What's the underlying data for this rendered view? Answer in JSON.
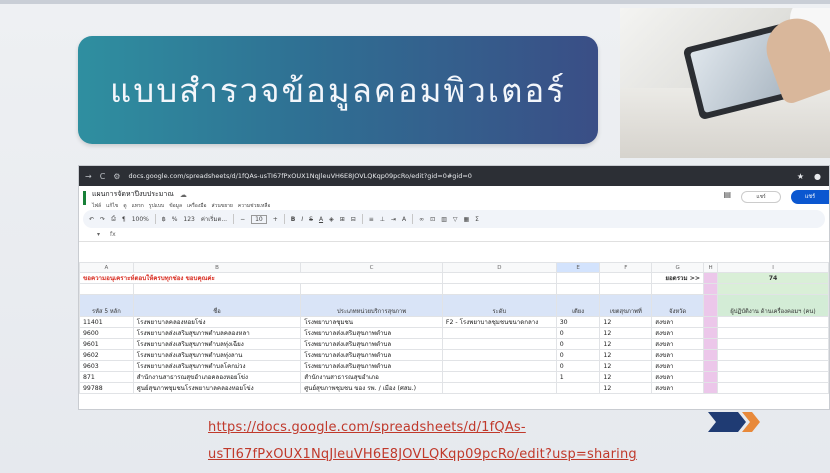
{
  "slide": {
    "title": "แบบสำรวจข้อมูลคอมพิวเตอร์",
    "link_line1": "https://docs.google.com/spreadsheets/d/1fQAs-",
    "link_line2": "usTI67fPxOUX1NqJleuVH6E8JOVLQKqp09pcRo/edit?usp=sharing"
  },
  "browser": {
    "url": "docs.google.com/spreadsheets/d/1fQAs-usTI67fPxOUX1NqJleuVH6E8JOVLQKqp09pcRo/edit?gid=0#gid=0",
    "nav_refresh": "C"
  },
  "sheet": {
    "doc_title": "แผนการจัดหาปีงบประมาณ",
    "menus": [
      "ไฟล์",
      "แก้ไข",
      "ดู",
      "แทรก",
      "รูปแบบ",
      "ข้อมูล",
      "เครื่องมือ",
      "ส่วนขยาย",
      "ความช่วยเหลือ"
    ],
    "share_label": "แชร์",
    "account_label": "แชร์",
    "toolbar": {
      "zoom": "100%",
      "currency": "฿",
      "percent": "%",
      "format_123": "123",
      "font": "ค่าเริ่มต...",
      "font_size": "10"
    },
    "fx_label": "fx",
    "cell_ref": "▾",
    "columns": [
      "A",
      "B",
      "C",
      "D",
      "E",
      "F",
      "G",
      "H",
      "I"
    ],
    "notice": "ขอความอนุเคราะห์ตอบให้ครบทุกช่อง ขอบคุณค่ะ",
    "total_label": "ยอดรวม >>",
    "total_value": "74",
    "headers": {
      "code": "รหัส 5 หลัก",
      "name": "ชื่อ",
      "type": "ประเภทหน่วยบริการสุขภาพ",
      "level": "ระดับ",
      "beds": "เตียง",
      "region": "เขตสุขภาพที่",
      "province": "จังหวัด",
      "staff": "ผู้ปฏิบัติงาน ด้านเครื่องคอมฯ (คน)"
    },
    "rows": [
      {
        "code": "11401",
        "name": "โรงพยาบาลคลองหอยโข่ง",
        "type": "โรงพยาบาลชุมชน",
        "level": "F2 - โรงพยาบาลชุมชนขนาดกลาง",
        "beds": "30",
        "region": "12",
        "province": "สงขลา"
      },
      {
        "code": "9600",
        "name": "โรงพยาบาลส่งเสริมสุขภาพตำบลคลองหลา",
        "type": "โรงพยาบาลส่งเสริมสุขภาพตำบล",
        "level": "",
        "beds": "0",
        "region": "12",
        "province": "สงขลา"
      },
      {
        "code": "9601",
        "name": "โรงพยาบาลส่งเสริมสุขภาพตำบลทุ่งเฉียง",
        "type": "โรงพยาบาลส่งเสริมสุขภาพตำบล",
        "level": "",
        "beds": "0",
        "region": "12",
        "province": "สงขลา"
      },
      {
        "code": "9602",
        "name": "โรงพยาบาลส่งเสริมสุขภาพตำบลทุ่งลาน",
        "type": "โรงพยาบาลส่งเสริมสุขภาพตำบล",
        "level": "",
        "beds": "0",
        "region": "12",
        "province": "สงขลา"
      },
      {
        "code": "9603",
        "name": "โรงพยาบาลส่งเสริมสุขภาพตำบลโคกม่วง",
        "type": "โรงพยาบาลส่งเสริมสุขภาพตำบล",
        "level": "",
        "beds": "0",
        "region": "12",
        "province": "สงขลา"
      },
      {
        "code": "871",
        "name": "สำนักงานสาธารณสุขอำเภอคลองหอยโข่ง",
        "type": "สำนักงานสาธารณสุขอำเภอ",
        "level": "",
        "beds": "1",
        "region": "12",
        "province": "สงขลา"
      },
      {
        "code": "99788",
        "name": "ศูนย์สุขภาพชุมชนโรงพยาบาลคลองหอยโข่ง",
        "type": "ศูนย์สุขภาพชุมชน ของ รพ. / เมือง (ศสม.)",
        "level": "",
        "beds": "",
        "region": "12",
        "province": "สงขลา"
      }
    ]
  },
  "colors": {
    "banner_start": "#2f8fa0",
    "banner_end": "#3a4e86",
    "link": "#c0392b",
    "arrow_dark": "#1f3b73",
    "arrow_orange": "#e8893a"
  }
}
